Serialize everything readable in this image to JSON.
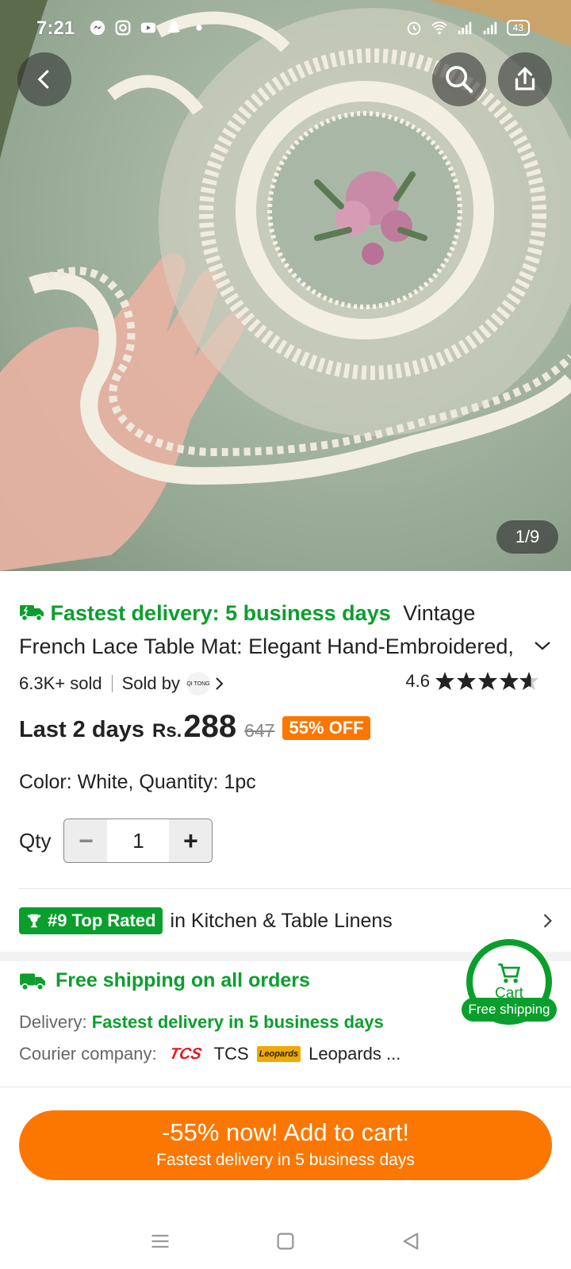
{
  "status_bar": {
    "time": "7:21",
    "battery": "43",
    "left_icons": [
      "messenger-icon",
      "instagram-icon",
      "youtube-icon",
      "snapchat-icon",
      "dot-icon"
    ],
    "right_icons": [
      "alarm-icon",
      "wifi-icon",
      "signal-icon",
      "signal-icon",
      "battery-icon"
    ]
  },
  "gallery": {
    "counter": "1/9"
  },
  "product": {
    "delivery_badge": "Fastest delivery: 5 business days",
    "title": "Vintage French Lace Table Mat: Elegant Hand-Embroidered, Suit",
    "sold": "6.3K+ sold",
    "sold_by_label": "Sold by",
    "seller_logo_text": "QI TONG",
    "rating": "4.6",
    "rating_value": 4.6,
    "price_prefix": "Last 2 days",
    "currency": "Rs.",
    "price": "288",
    "original_price": "647",
    "discount": "55% OFF",
    "variant_label": "Color:",
    "variant_value": "White, Quantity: 1pc"
  },
  "quantity": {
    "label": "Qty",
    "minus": "−",
    "value": "1",
    "plus": "+"
  },
  "ranking": {
    "badge": "#9 Top Rated",
    "category": "in Kitchen & Table Linens"
  },
  "shipping": {
    "title": "Free shipping on all orders",
    "delivery_label": "Delivery:",
    "delivery_value": "Fastest delivery in 5 business days",
    "courier_label": "Courier company:",
    "courier_1": "TCS",
    "courier_2": "Leopards ...",
    "courier_1_logo": "TCS",
    "courier_2_logo": "Leopards"
  },
  "cart_float": {
    "label": "Cart",
    "badge": "Free shipping"
  },
  "cta": {
    "main": "-55% now! Add to cart!",
    "sub": "Fastest delivery in 5 business days"
  },
  "colors": {
    "green": "#0a9f2c",
    "orange": "#fb7701"
  }
}
